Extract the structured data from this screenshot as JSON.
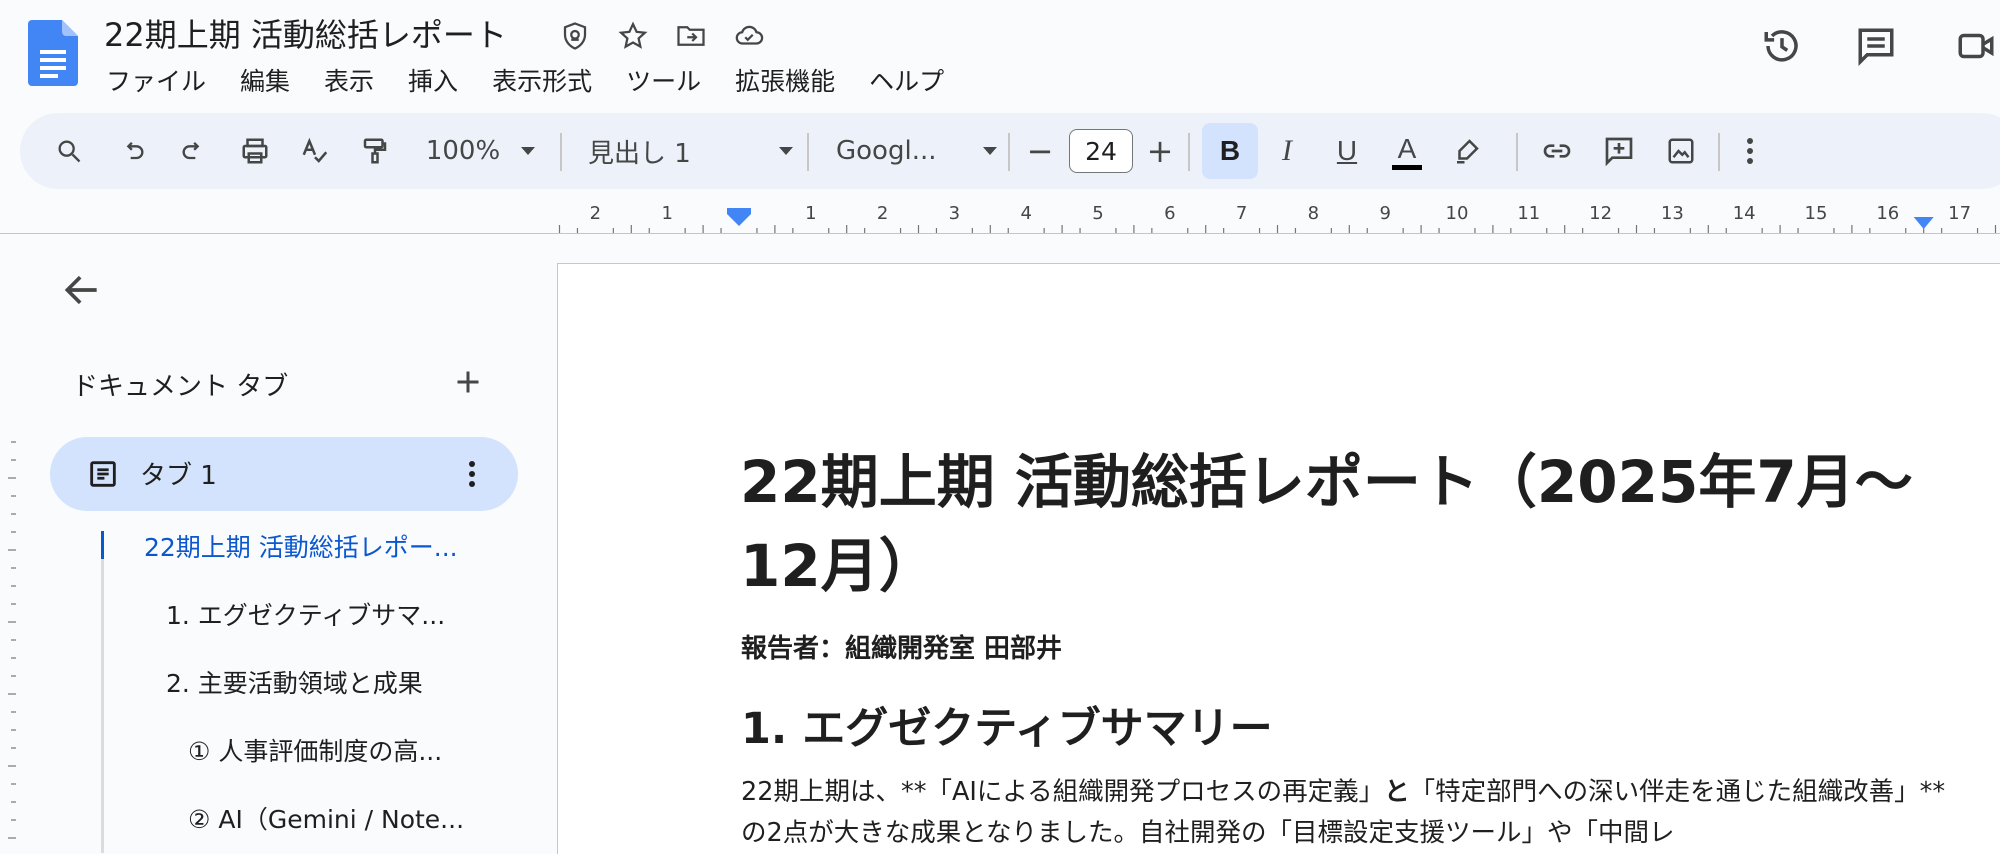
{
  "app": {
    "title": "22期上期 活動総括レポート",
    "menus": [
      "ファイル",
      "編集",
      "表示",
      "挿入",
      "表示形式",
      "ツール",
      "拡張機能",
      "ヘルプ"
    ]
  },
  "toolbar": {
    "zoom": "100%",
    "style": "見出し 1",
    "font": "Googl...",
    "font_size": "24",
    "minus": "−",
    "plus": "+",
    "bold": "B",
    "italic": "I",
    "underline": "U",
    "text_color": "A"
  },
  "ruler": {
    "left_numbers": [
      "2",
      "1"
    ],
    "numbers": [
      "1",
      "2",
      "3",
      "4",
      "5",
      "6",
      "7",
      "8",
      "9",
      "10",
      "11",
      "12",
      "13",
      "14",
      "15",
      "16",
      "17"
    ]
  },
  "sidebar": {
    "section_label": "ドキュメント タブ",
    "tab_label": "タブ 1",
    "outline": [
      "22期上期 活動総括レポー...",
      "1. エグゼクティブサマ...",
      "2. 主要活動領域と成果",
      "① 人事評価制度の高...",
      "② AI（Gemini / Note..."
    ]
  },
  "document": {
    "title": "22期上期 活動総括レポート（2025年7月〜12月）",
    "reporter": "報告者：組織開発室 田部井",
    "heading1": "1. エグゼクティブサマリー",
    "para_1": "22期上期は、**「AIによる組織開発プロセスの再定義」",
    "para_bold": "と",
    "para_2": "「特定部門への深い伴走を通じた組織改善」**の2点が大きな成果となりました。自社開発の「目標設定支援ツール」や「中間レ"
  },
  "colors": {
    "accent": "#0b57d0",
    "docs_blue": "#4285f4",
    "pill": "#d3e3fd",
    "toolbar_bg": "#edf2fa"
  }
}
